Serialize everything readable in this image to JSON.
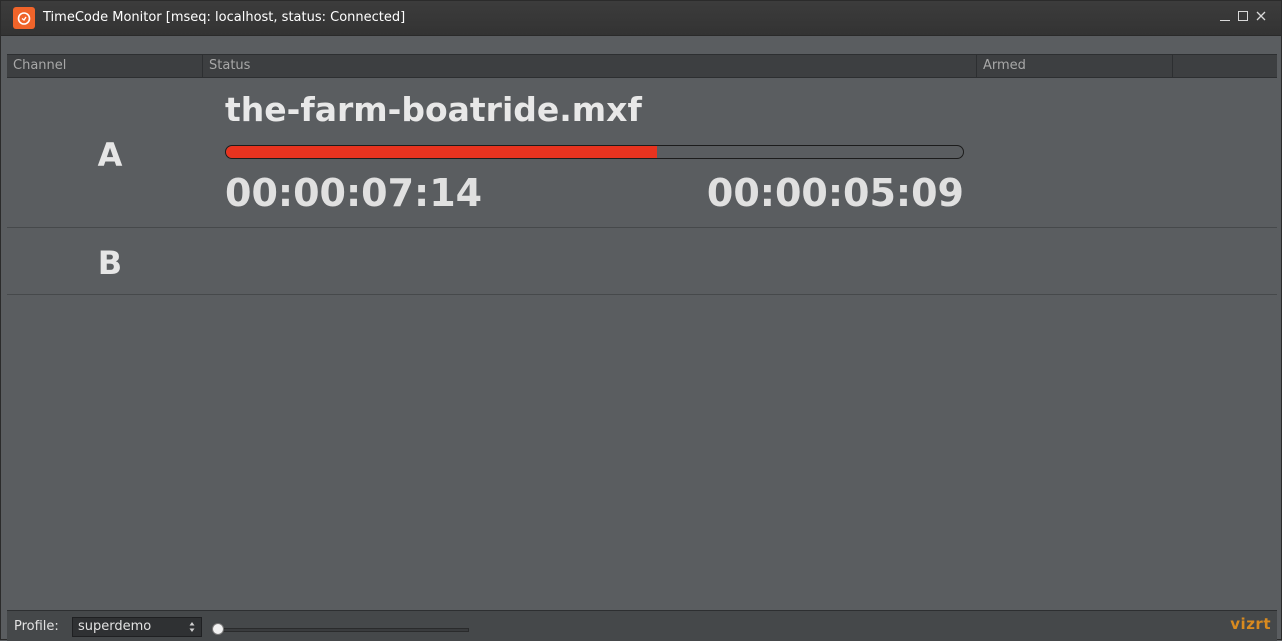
{
  "window": {
    "title": "TimeCode Monitor [mseq: localhost, status: Connected]",
    "icon": "stopwatch-icon"
  },
  "table": {
    "columns": [
      "Channel",
      "Status",
      "Armed",
      ""
    ]
  },
  "channels": [
    {
      "label": "A",
      "clip": "the-farm-boatride.mxf",
      "progress": 0.585,
      "elapsed": "00:00:07:14",
      "remaining": "00:00:05:09"
    },
    {
      "label": "B",
      "clip": "",
      "progress": 0,
      "elapsed": "",
      "remaining": ""
    }
  ],
  "footer": {
    "profile_label": "Profile:",
    "profile_value": "superdemo",
    "zoom": 0.0,
    "brand": "vizrt"
  },
  "colors": {
    "accent": "#f0642a",
    "progress_fill": "#e8331f",
    "brand": "#d88a1f"
  }
}
